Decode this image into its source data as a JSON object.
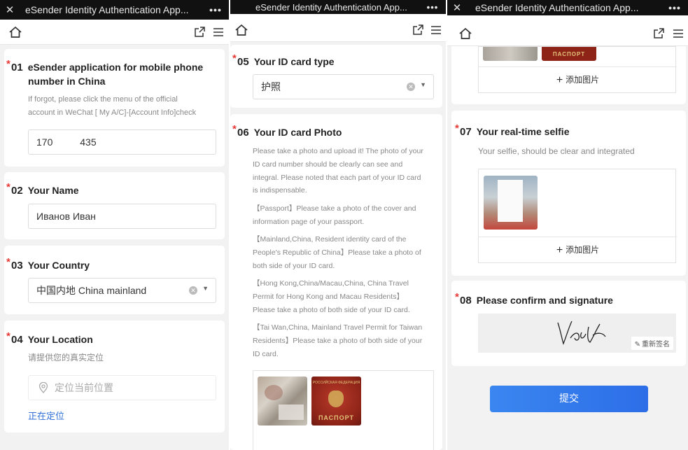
{
  "window": {
    "title": "eSender Identity Authentication App...",
    "title_short": "eSender Identity Authentication App...",
    "title_mid": "eSender Identity Authentication App..."
  },
  "form": {
    "q01": {
      "num": "01",
      "label_line1": "eSender application for mobile phone",
      "label_line2": "number in China",
      "hint_line1": "If forgot, please click the menu of the official",
      "hint_line2": "account in WeChat [ My A/C]-[Account Info]check",
      "value": "170          435"
    },
    "q02": {
      "num": "02",
      "label": "Your Name",
      "value": "Иванов Иван"
    },
    "q03": {
      "num": "03",
      "label": "Your Country",
      "value": "中国内地 China mainland"
    },
    "q04": {
      "num": "04",
      "label": "Your Location",
      "hint": "请提供您的真实定位",
      "placeholder": "定位当前位置",
      "status": "正在定位"
    },
    "q05": {
      "num": "05",
      "label": "Your ID card type",
      "value": "护照"
    },
    "q06": {
      "num": "06",
      "label": "Your ID card Photo",
      "intro": [
        "Please take a photo and upload it! The photo of your",
        "ID card number should be clearly can see and",
        "integral. Please noted that each part of your ID card",
        "is indispensable."
      ],
      "passport": [
        "【Passport】Please take a photo of the cover and",
        "information page of your passport."
      ],
      "mainland": [
        "【Mainland,China, Resident identity card of the",
        "People's Republic of China】Please take a photo of",
        "both side of your ID card."
      ],
      "hkmacau": [
        "【Hong Kong,China/Macau,China, China Travel",
        "Permit for Hong Kong and Macau Residents】",
        "Please take a photo of both side of your ID card."
      ],
      "taiwan": [
        "【Tai Wan,China, Mainland Travel Permit for Taiwan",
        "Residents】Please take a photo of both side of your",
        "ID card."
      ],
      "passport_cover_text_top": "РОССИЙСКАЯ ФЕДЕРАЦИЯ",
      "passport_cover_text": "ПАСПОРТ",
      "add_image": "添加图片"
    },
    "q07": {
      "num": "07",
      "label": "Your real-time selfie",
      "hint": "Your selfie, should be clear and integrated",
      "add_image": "添加图片"
    },
    "q08": {
      "num": "08",
      "label": "Please confirm and signature",
      "resign": "重新签名"
    },
    "submit": "提交"
  },
  "colors": {
    "accent": "#2f6fd6",
    "required": "#e53935",
    "button": "#3a86f0"
  },
  "icons": [
    "close-icon",
    "more-icon",
    "home-icon",
    "share-icon",
    "menu-icon",
    "location-pin-icon",
    "clear-icon",
    "dropdown-arrow-icon",
    "plus-icon",
    "edit-icon"
  ]
}
